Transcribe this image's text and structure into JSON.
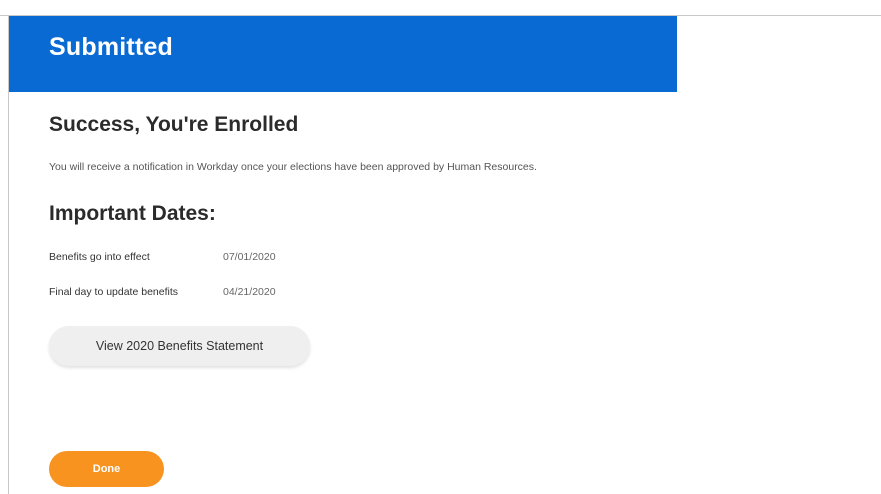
{
  "header": {
    "title": "Submitted",
    "background_color": "#0a6ad3"
  },
  "confirmation": {
    "title": "Success, You're Enrolled",
    "message": "You will receive a notification in Workday once your elections have been approved by Human Resources."
  },
  "important_dates": {
    "title": "Important Dates:",
    "rows": [
      {
        "label": "Benefits go into effect",
        "value": "07/01/2020"
      },
      {
        "label": "Final day to update benefits",
        "value": "04/21/2020"
      }
    ]
  },
  "actions": {
    "statement_button_label": "View 2020 Benefits Statement",
    "done_button_label": "Done",
    "done_button_color": "#f7931e"
  }
}
